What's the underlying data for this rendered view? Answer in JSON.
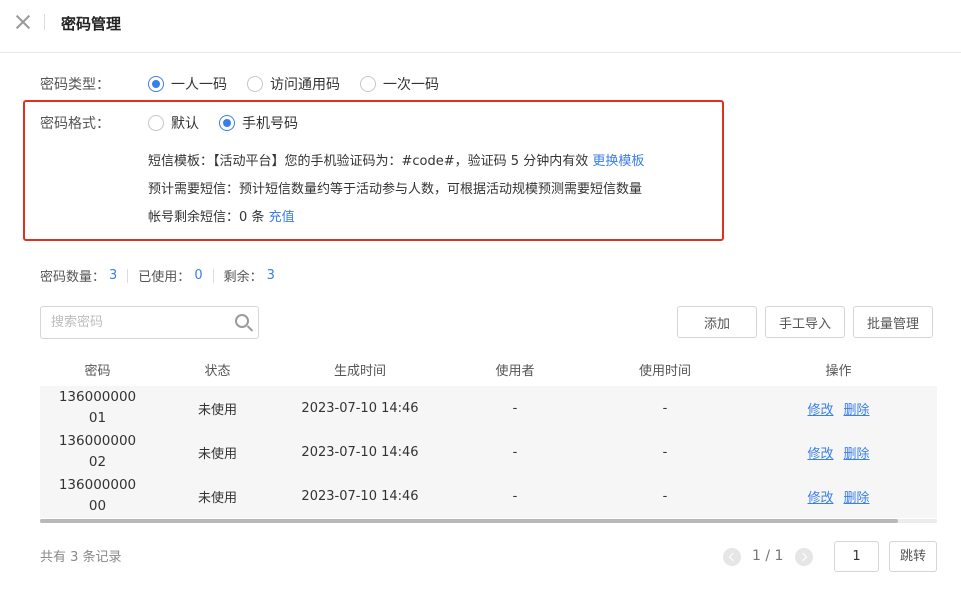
{
  "dialog": {
    "title": "密码管理"
  },
  "password_type": {
    "label": "密码类型：",
    "options": [
      "一人一码",
      "访问通用码",
      "一次一码"
    ],
    "selected": "一人一码"
  },
  "password_format": {
    "label": "密码格式：",
    "options": [
      "默认",
      "手机号码"
    ],
    "selected": "手机号码"
  },
  "sms": {
    "template_label": "短信模板：",
    "template_text": "【活动平台】您的手机验证码为：#code#，验证码 5 分钟内有效",
    "change_template_link": "更换模板",
    "estimate_label": "预计需要短信：",
    "estimate_text": "预计短信数量约等于活动参与人数，可根据活动规模预测需要短信数量",
    "remaining_label": "帐号剩余短信：",
    "remaining_text": "0 条",
    "recharge_link": "充值"
  },
  "stats": {
    "count_label": "密码数量：",
    "count": "3",
    "used_label": "已使用：",
    "used": "0",
    "remaining_label": "剩余：",
    "remaining": "3"
  },
  "search": {
    "placeholder": "搜索密码",
    "value": ""
  },
  "toolbar": {
    "add": "添加",
    "manual_import": "手工导入",
    "batch": "批量管理"
  },
  "table": {
    "headers": [
      "密码",
      "状态",
      "生成时间",
      "使用者",
      "使用时间",
      "操作"
    ],
    "rows": [
      {
        "password": "13600000001",
        "status": "未使用",
        "created": "2023-07-10 14:46",
        "user": "-",
        "used_time": "-",
        "edit": "修改",
        "delete": "删除"
      },
      {
        "password": "13600000002",
        "status": "未使用",
        "created": "2023-07-10 14:46",
        "user": "-",
        "used_time": "-",
        "edit": "修改",
        "delete": "删除"
      },
      {
        "password": "13600000000",
        "status": "未使用",
        "created": "2023-07-10 14:46",
        "user": "-",
        "used_time": "-",
        "edit": "修改",
        "delete": "删除"
      }
    ]
  },
  "footer": {
    "total": "共有 3 条记录",
    "page_display": "1 / 1",
    "page_input": "1",
    "jump": "跳转"
  },
  "colors": {
    "accent": "#3a7ee9",
    "highlight_border": "#e0301e"
  }
}
